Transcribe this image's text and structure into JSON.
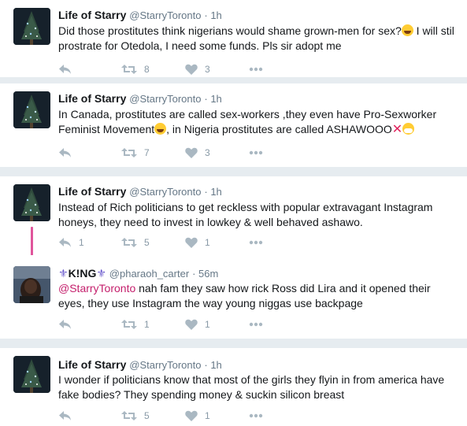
{
  "tweets": [
    {
      "name": "Life of Starry",
      "handle": "@StarryToronto",
      "time": "· 1h",
      "text_a": "Did those prostitutes think nigerians would shame grown-men for sex?",
      "text_b": " I will stil prostrate for Otedola, I need some funds. Pls sir adopt me",
      "emoji_a": "face-with-tears-of-joy",
      "retweets": "8",
      "likes": "3"
    },
    {
      "name": "Life of Starry",
      "handle": "@StarryToronto",
      "time": "· 1h",
      "text_a": "In Canada, prostitutes are called sex-workers ,they even have Pro-Sexworker Feminist Movement",
      "text_b": ", in Nigeria prostitutes are called ASHAWOOO",
      "emoji_a": "face-with-tears-of-joy",
      "emoji_b": "cross-mark",
      "emoji_c": "face-with-medical-mask",
      "retweets": "7",
      "likes": "3"
    },
    {
      "name": "Life of Starry",
      "handle": "@StarryToronto",
      "time": "· 1h",
      "text": "Instead of Rich politicians to get reckless with popular extravagant Instagram honeys, they need to invest in lowkey & well behaved ashawo.",
      "replies": "1",
      "retweets": "5",
      "likes": "1"
    },
    {
      "crown_left": "⚜",
      "name": "K!NG",
      "crown_right": "⚜",
      "handle": "@pharaoh_carter",
      "time": "· 56m",
      "mention": "@StarryToronto",
      "text": " nah fam they saw how rick Ross did Lira and it opened their eyes, they use Instagram the way young niggas use backpage",
      "retweets": "1",
      "likes": "1"
    },
    {
      "name": "Life of Starry",
      "handle": "@StarryToronto",
      "time": "· 1h",
      "text": "I wonder if politicians know that most of the girls they flyin in from america have fake bodies? They spending money & suckin silicon breast",
      "retweets": "5",
      "likes": "1"
    }
  ],
  "colors": {
    "text": "#14171a",
    "muted": "#657786",
    "icon": "#8899a6",
    "mention": "#c41f6c",
    "thread": "#e0559b",
    "separator": "#e6ecf0"
  },
  "icons": [
    "reply-icon",
    "retweet-icon",
    "heart-icon",
    "more-icon"
  ]
}
